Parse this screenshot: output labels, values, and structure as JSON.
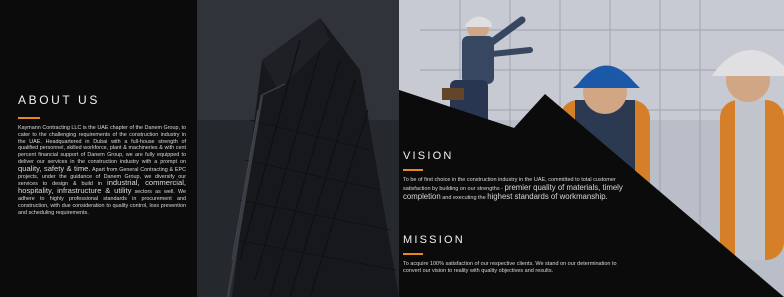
{
  "about": {
    "heading": "ABOUT US",
    "body_1": "Kaymann Contracting LLC is the UAE chapter of the Danem Group, to cater to the challenging requirements of the construction industry in the UAE. Headquartered in Dubai with a full-house strength of qualified personnel, skilled workforce, plant & machineries & with cent percent financial support of Danem Group, we are fully equipped to deliver our services in the construction industry with a prompt on",
    "emph_1": "quality, safety & time.",
    "body_2": "Apart from General Contracting & EPC projects, under the guidance of Danem Group, we diversify our services to design & build in",
    "emph_2": "industrial, commercial, hospitality, infrastructure & utility",
    "body_3": "sectors as well. We adhere to highly professional standards in procurement and construction, with due consideration to quality control, loss prevention and scheduling requirements."
  },
  "vision": {
    "heading": "VISION",
    "body_1": "To be of first choice in the construction industry in the UAE, committed to total customer satisfaction by building on our strengths -",
    "emph_1": "premier quality of materials, timely completion",
    "body_2": "and executing the",
    "emph_2": "highest standards of workmanship."
  },
  "mission": {
    "heading": "MISSION",
    "body": "To acquire 100% satisfaction of our respective clients. We stand on our determination to convert our vision to reality with quality objectives and results."
  },
  "colors": {
    "accent": "#e28a1a",
    "panel": "#0b0b0b",
    "sky": "#c9ced6",
    "building": "#24262b",
    "hardhat_blue": "#1e5fb4",
    "hardhat_white": "#f2f2f2",
    "safety_vest": "#e6892a"
  },
  "images": {
    "left_photo": "high-rise-building-under-construction-with-crane",
    "right_photo": "construction-workers-with-hard-hats"
  }
}
